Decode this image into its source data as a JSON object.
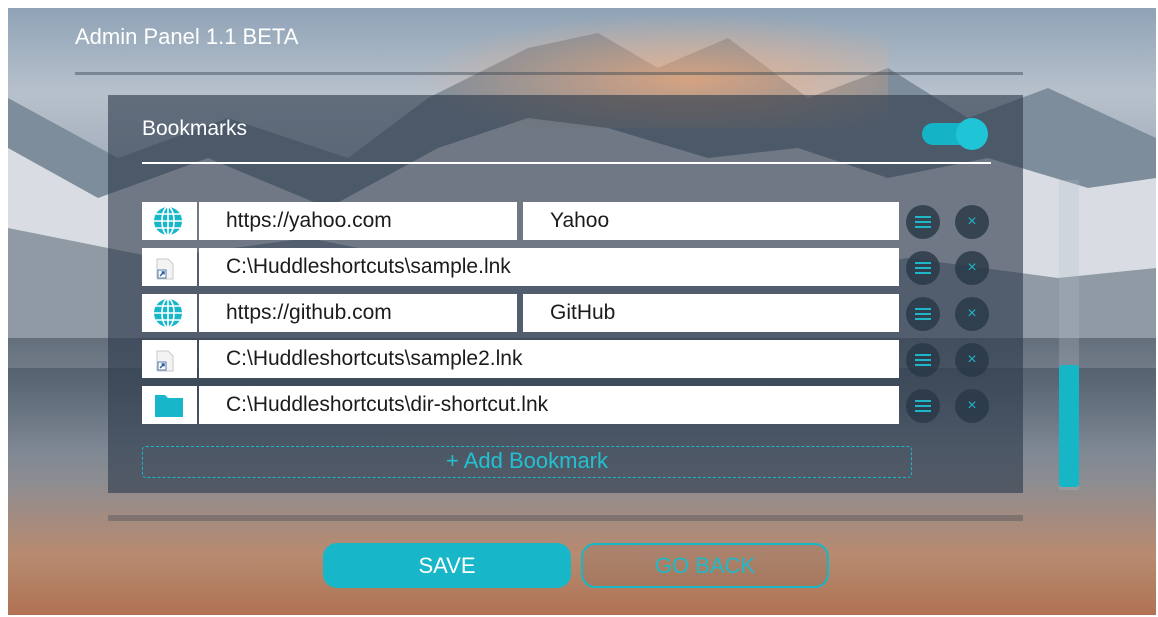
{
  "app": {
    "title": "Admin Panel 1.1 BETA"
  },
  "section": {
    "title": "Bookmarks",
    "toggle_on": true
  },
  "bookmarks": [
    {
      "icon": "globe-icon",
      "type": "url",
      "url": "https://yahoo.com",
      "name": "Yahoo"
    },
    {
      "icon": "shortcut-file-icon",
      "type": "path",
      "path": "C:\\Huddleshortcuts\\sample.lnk"
    },
    {
      "icon": "globe-icon",
      "type": "url",
      "url": "https://github.com",
      "name": "GitHub"
    },
    {
      "icon": "shortcut-file-icon",
      "type": "path",
      "path": "C:\\Huddleshortcuts\\sample2.lnk"
    },
    {
      "icon": "folder-icon",
      "type": "path",
      "path": "C:\\Huddleshortcuts\\dir-shortcut.lnk"
    }
  ],
  "actions": {
    "add_bookmark": "+ Add Bookmark",
    "save": "SAVE",
    "go_back": "GO BACK",
    "row_menu_icon": "menu-lines-icon",
    "row_remove_icon": "close-icon",
    "remove_glyph": "×"
  },
  "colors": {
    "accent": "#17b7c9",
    "panel": "#2d3a4a"
  }
}
